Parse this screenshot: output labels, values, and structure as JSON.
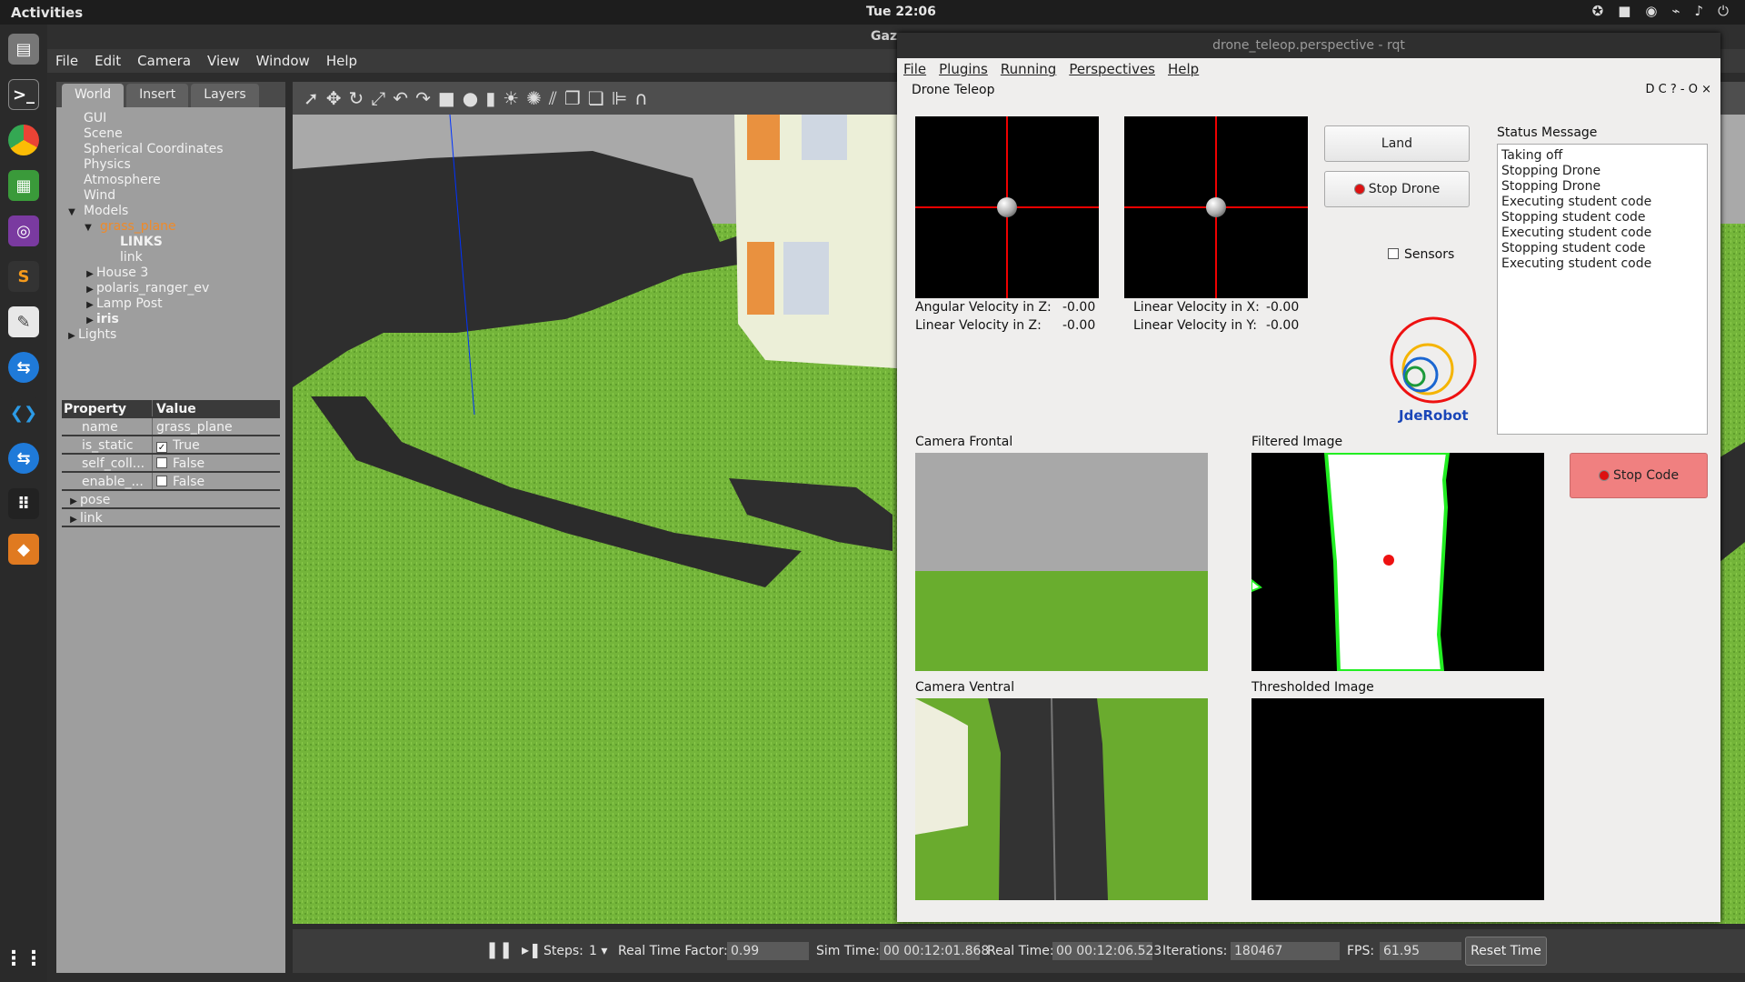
{
  "topbar": {
    "activities": "Activities",
    "clock": "Tue 22:06"
  },
  "gazebo": {
    "title": "Gaz",
    "menu": [
      "File",
      "Edit",
      "Camera",
      "View",
      "Window",
      "Help"
    ],
    "tabs": [
      "World",
      "Insert",
      "Layers"
    ],
    "tree": {
      "gui": "GUI",
      "scene": "Scene",
      "spherical": "Spherical Coordinates",
      "physics": "Physics",
      "atmosphere": "Atmosphere",
      "wind": "Wind",
      "models": "Models",
      "grass_plane": "grass_plane",
      "links": "LINKS",
      "link": "link",
      "house": "House 3",
      "polaris": "polaris_ranger_ev",
      "lamp": "Lamp Post",
      "iris": "iris",
      "lights": "Lights"
    },
    "props": {
      "head_prop": "Property",
      "head_val": "Value",
      "name_k": "name",
      "name_v": "grass_plane",
      "static_k": "is_static",
      "static_v": "True",
      "self_k": "self_coll...",
      "self_v": "False",
      "enable_k": "enable_...",
      "enable_v": "False",
      "pose": "pose",
      "link": "link"
    },
    "bottom": {
      "steps_label": "Steps:",
      "steps_value": "1",
      "rtf_label": "Real Time Factor:",
      "rtf_value": "0.99",
      "sim_label": "Sim Time:",
      "sim_value": "00 00:12:01.868",
      "real_label": "Real Time:",
      "real_value": "00 00:12:06.523",
      "iter_label": "Iterations:",
      "iter_value": "180467",
      "fps_label": "FPS:",
      "fps_value": "61.95",
      "reset": "Reset Time"
    }
  },
  "rqt": {
    "title": "drone_teleop.perspective - rqt",
    "menu": [
      "File",
      "Plugins",
      "Running",
      "Perspectives",
      "Help"
    ],
    "plugin_title": "Drone Teleop",
    "plugin_controls": "D C ? - O ×",
    "ang_z_label": "Angular Velocity in Z:",
    "ang_z_value": "-0.00",
    "lin_z_label": "Linear Velocity in Z:",
    "lin_z_value": "-0.00",
    "lin_x_label": "Linear Velocity in X:",
    "lin_x_value": "-0.00",
    "lin_y_label": "Linear Velocity in Y:",
    "lin_y_value": "-0.00",
    "land": "Land",
    "stop_drone": "Stop Drone",
    "sensors": "Sensors",
    "logo": "JdeRobot",
    "status_title": "Status Message",
    "status_lines": [
      "Taking off",
      "Stopping Drone",
      "Stopping Drone",
      "Executing student code",
      "Stopping student code",
      "Executing student code",
      "Stopping student code",
      "Executing student code"
    ],
    "cam_frontal": "Camera Frontal",
    "filtered": "Filtered Image",
    "cam_ventral": "Camera Ventral",
    "thresholded": "Thresholded Image",
    "stop_code": "Stop Code"
  }
}
